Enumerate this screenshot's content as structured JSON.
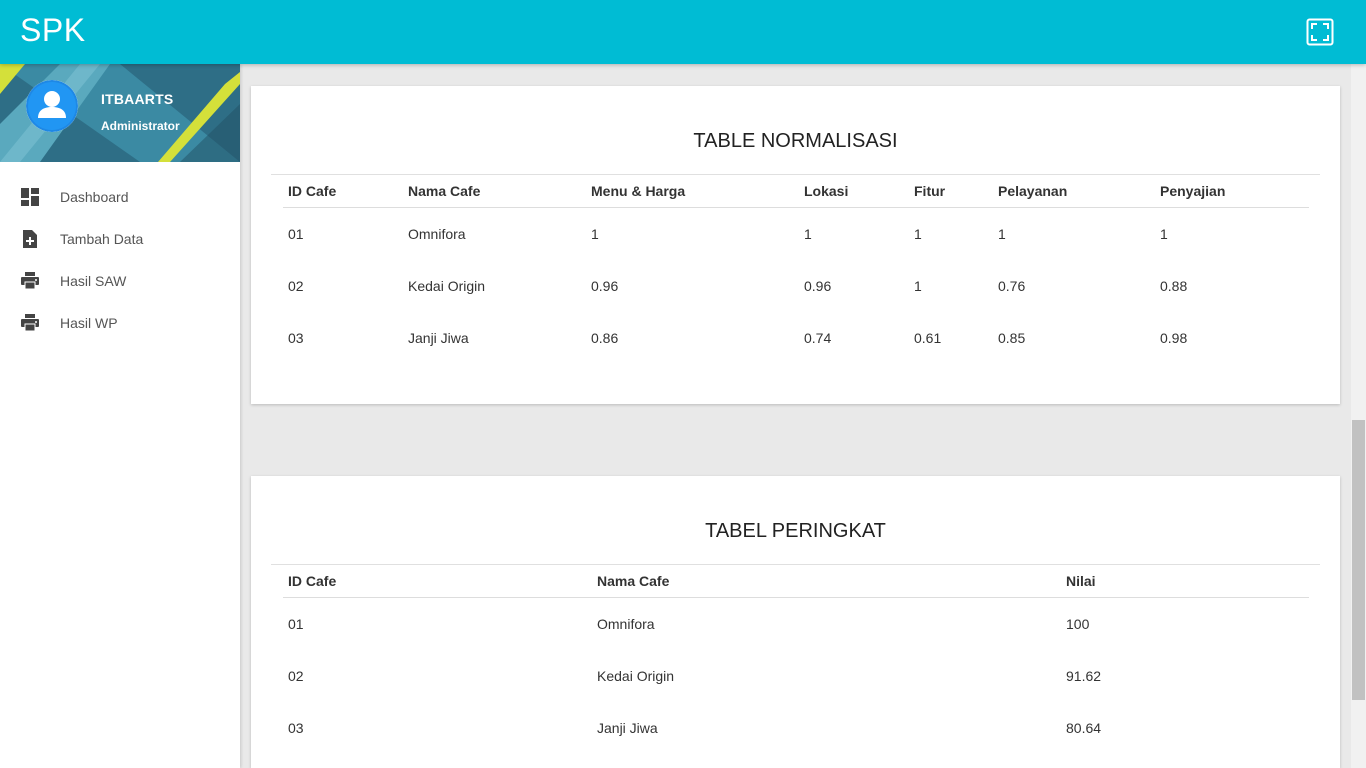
{
  "navbar": {
    "brand": "SPK",
    "fullscreen_icon": "fullscreen-icon"
  },
  "user": {
    "name": "ITBAARTS",
    "role": "Administrator",
    "avatar_icon": "person-icon"
  },
  "menu": [
    {
      "label": "Dashboard",
      "icon": "dashboard-icon"
    },
    {
      "label": "Tambah Data",
      "icon": "add-file-icon"
    },
    {
      "label": "Hasil SAW",
      "icon": "print-icon"
    },
    {
      "label": "Hasil WP",
      "icon": "print-icon"
    }
  ],
  "normalisasi": {
    "title": "TABLE NORMALISASI",
    "headers": [
      "ID Cafe",
      "Nama Cafe",
      "Menu & Harga",
      "Lokasi",
      "Fitur",
      "Pelayanan",
      "Penyajian"
    ],
    "rows": [
      [
        "01",
        "Omnifora",
        "1",
        "1",
        "1",
        "1",
        "1"
      ],
      [
        "02",
        "Kedai Origin",
        "0.96",
        "0.96",
        "1",
        "0.76",
        "0.88"
      ],
      [
        "03",
        "Janji Jiwa",
        "0.86",
        "0.74",
        "0.61",
        "0.85",
        "0.98"
      ]
    ]
  },
  "peringkat": {
    "title": "TABEL PERINGKAT",
    "headers": [
      "ID Cafe",
      "Nama Cafe",
      "Nilai"
    ],
    "rows": [
      [
        "01",
        "Omnifora",
        "100"
      ],
      [
        "02",
        "Kedai Origin",
        "91.62"
      ],
      [
        "03",
        "Janji Jiwa",
        "80.64"
      ]
    ]
  },
  "colors": {
    "primary": "#00bcd4",
    "sidebar_accent": "#d4e03a"
  }
}
